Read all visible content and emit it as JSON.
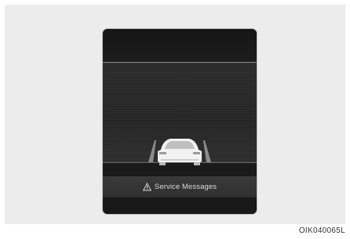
{
  "display": {
    "message": "Service Messages",
    "message_icon": "warning-icon"
  },
  "figure": {
    "code": "OIK040065L"
  },
  "colors": {
    "panel_background": "#1d1d1d",
    "road_surface": "#2b2b2b",
    "message_text": "#d9d9d9",
    "vehicle": "#f2f2f2"
  }
}
